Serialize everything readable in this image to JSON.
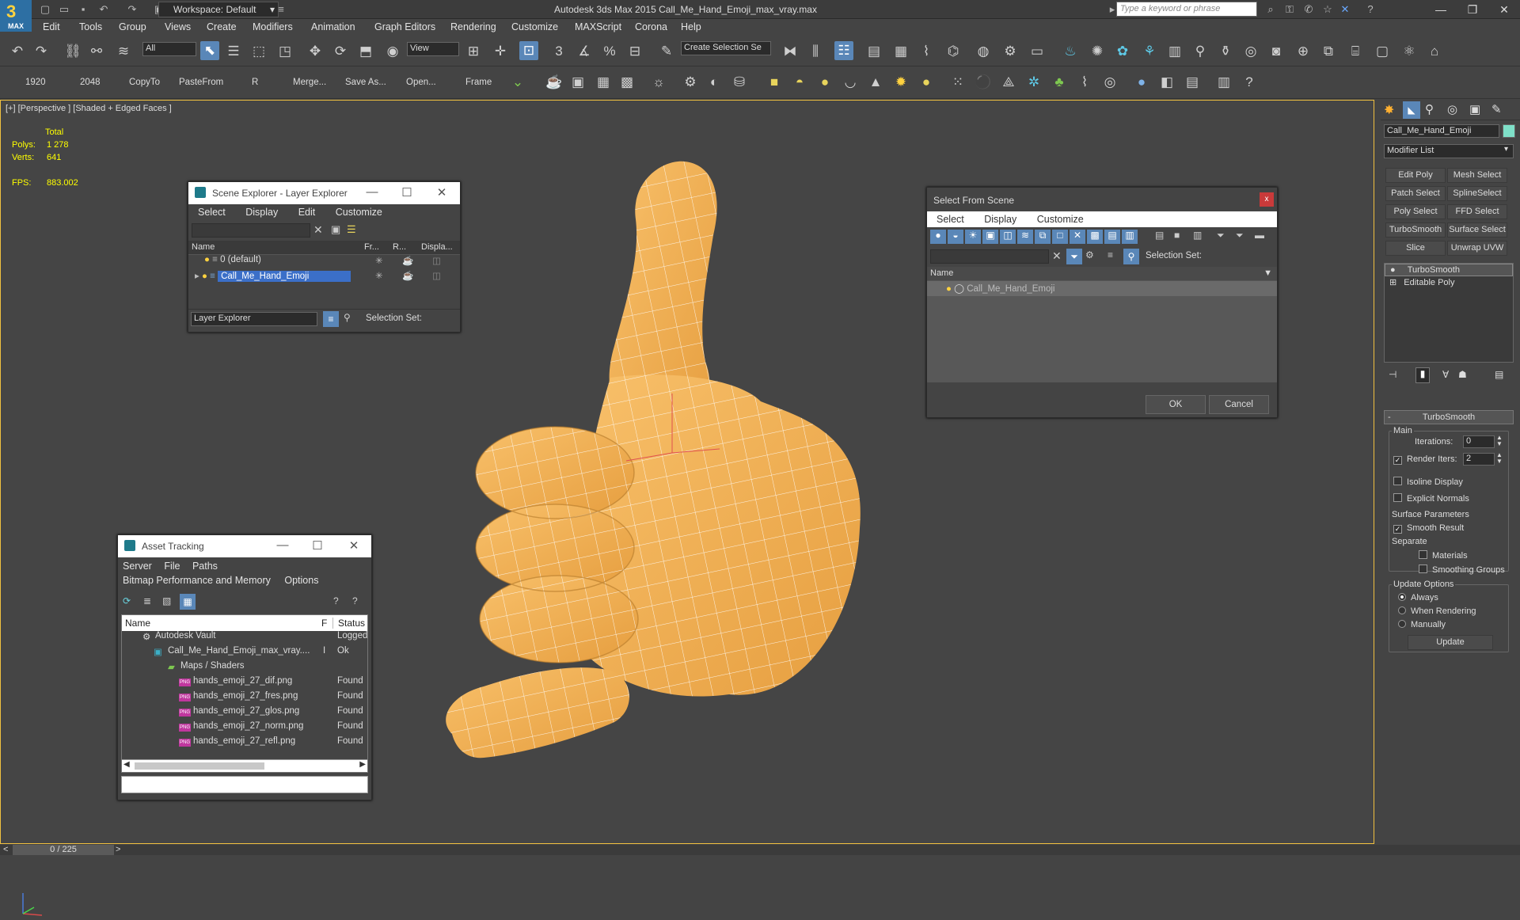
{
  "app": {
    "title": "Autodesk 3ds Max  2015     Call_Me_Hand_Emoji_max_vray.max",
    "workspace": "Workspace: Default",
    "search_placeholder": "Type a keyword or phrase",
    "logo": "MAX"
  },
  "menu": [
    "Edit",
    "Tools",
    "Group",
    "Views",
    "Create",
    "Modifiers",
    "Animation",
    "Graph Editors",
    "Rendering",
    "Customize",
    "MAXScript",
    "Corona",
    "Help"
  ],
  "toolbar1": {
    "selection_filter": "All",
    "ref_coord": "View",
    "named_selection": "Create Selection Se"
  },
  "toolbar2": {
    "labels": [
      "1920",
      "2048",
      "CopyTo",
      "PasteFrom",
      "R",
      "Merge...",
      "Save As...",
      "Open...",
      "Frame"
    ]
  },
  "viewport": {
    "label": "[+] [Perspective ] [Shaded + Edged Faces ]",
    "stats_total": "Total",
    "polys_key": "Polys:",
    "polys": "1 278",
    "verts_key": "Verts:",
    "verts": "641",
    "fps_key": "FPS:",
    "fps": "883.002"
  },
  "scene_explorer": {
    "title": "Scene Explorer - Layer Explorer",
    "menu": [
      "Select",
      "Display",
      "Edit",
      "Customize"
    ],
    "columns": [
      "Name",
      "Fr...",
      "R...",
      "Displa..."
    ],
    "rows": [
      "0 (default)",
      "Call_Me_Hand_Emoji"
    ],
    "footer_dropdown": "Layer Explorer",
    "footer_label": "Selection Set:"
  },
  "select_from_scene": {
    "title": "Select From Scene",
    "menu": [
      "Select",
      "Display",
      "Customize"
    ],
    "selection_set_label": "Selection Set:",
    "column": "Name",
    "rows": [
      "Call_Me_Hand_Emoji"
    ],
    "ok": "OK",
    "cancel": "Cancel"
  },
  "asset_tracking": {
    "title": "Asset Tracking",
    "menu1": [
      "Server",
      "File",
      "Paths"
    ],
    "menu2": [
      "Bitmap Performance and Memory",
      "Options"
    ],
    "columns": [
      "Name",
      "F",
      "Status"
    ],
    "rows": [
      {
        "name": "Autodesk Vault",
        "flag": "",
        "status": "Logged"
      },
      {
        "name": "Call_Me_Hand_Emoji_max_vray....",
        "flag": "I",
        "status": "Ok"
      },
      {
        "name": "Maps / Shaders",
        "flag": "",
        "status": ""
      },
      {
        "name": "hands_emoji_27_dif.png",
        "flag": "",
        "status": "Found"
      },
      {
        "name": "hands_emoji_27_fres.png",
        "flag": "",
        "status": "Found"
      },
      {
        "name": "hands_emoji_27_glos.png",
        "flag": "",
        "status": "Found"
      },
      {
        "name": "hands_emoji_27_norm.png",
        "flag": "",
        "status": "Found"
      },
      {
        "name": "hands_emoji_27_refl.png",
        "flag": "",
        "status": "Found"
      }
    ]
  },
  "command_panel": {
    "object_name": "Call_Me_Hand_Emoji",
    "object_color": "#7fe0c8",
    "modifier_list": "Modifier List",
    "modifier_buttons": [
      "Edit Poly",
      "Mesh Select",
      "Patch Select",
      "SplineSelect",
      "Poly Select",
      "FFD Select",
      "TurboSmooth",
      "Surface Select",
      "Slice",
      "Unwrap UVW"
    ],
    "stack": [
      "TurboSmooth",
      "Editable Poly"
    ],
    "rollout_title": "TurboSmooth",
    "main_label": "Main",
    "iterations_label": "Iterations:",
    "iterations": "0",
    "render_iters_label": "Render Iters:",
    "render_iters": "2",
    "isoline": "Isoline Display",
    "explicit": "Explicit Normals",
    "surface_params": "Surface Parameters",
    "smooth_result": "Smooth Result",
    "separate": "Separate",
    "materials": "Materials",
    "smoothing_groups": "Smoothing Groups",
    "update_options": "Update Options",
    "always": "Always",
    "when_rendering": "When Rendering",
    "manually": "Manually",
    "update_button": "Update"
  },
  "status": {
    "frame": "0 / 225"
  },
  "colors": {
    "hand": "#f7b558",
    "selection": "#3b6fc8",
    "viewport_border": "#f0c040"
  }
}
